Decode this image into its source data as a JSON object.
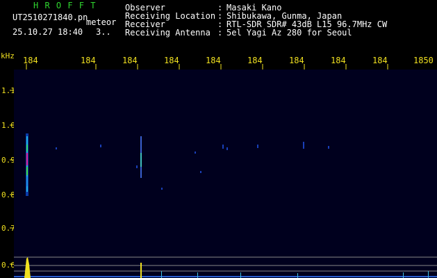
{
  "app": {
    "name": "H R O F F T"
  },
  "file": {
    "name": "UT2510271840.pn",
    "tag": "meteor",
    "datetime": "25.10.27 18:40",
    "count": "3.."
  },
  "info": {
    "rows": [
      {
        "label": "Observer",
        "sep": ":",
        "value": "Masaki Kano"
      },
      {
        "label": "Receiving Location",
        "sep": ":",
        "value": "Shibukawa, Gunma, Japan"
      },
      {
        "label": "Receiver",
        "sep": ":",
        "value": "RTL-SDR SDR# 43dB L15 96.7MHz CW"
      },
      {
        "label": "Receiving Antenna",
        "sep": ":",
        "value": "5el Yagi Az 280 for Seoul"
      }
    ]
  },
  "axes": {
    "y_unit": "kHz",
    "y_ticks": [
      "1.1",
      "1.0",
      "0.9",
      "0.8",
      "0.7",
      "0.6"
    ],
    "x_ticks": [
      "184",
      "184",
      "184",
      "184",
      "184",
      "184",
      "184",
      "184",
      "184",
      "1850"
    ]
  },
  "colors": {
    "background": "#000000",
    "plot_bg": "#00001e",
    "label_yellow": "#f0e020",
    "title_green": "#2fd52f"
  },
  "display": {
    "type": "spectrogram",
    "band_y_khz": [
      0.8,
      1.0
    ],
    "meteor_echo_y_khz": 0.9
  }
}
